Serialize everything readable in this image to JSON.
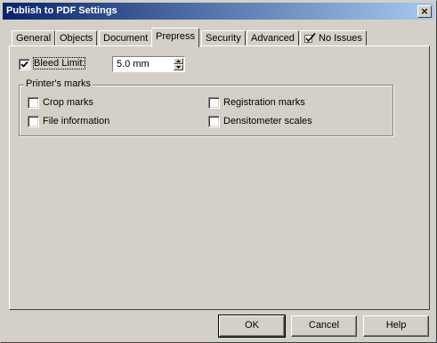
{
  "window": {
    "title": "Publish to PDF Settings",
    "close_label": "×"
  },
  "tabs": [
    {
      "label": "General",
      "active": false
    },
    {
      "label": "Objects",
      "active": false
    },
    {
      "label": "Document",
      "active": false
    },
    {
      "label": "Prepress",
      "active": true
    },
    {
      "label": "Security",
      "active": false
    },
    {
      "label": "Advanced",
      "active": false
    },
    {
      "label": "No Issues",
      "active": false,
      "icon": "check-issues-icon"
    }
  ],
  "prepress": {
    "bleed_limit": {
      "label": "Bleed Limit:",
      "checked": true,
      "value": "5.0 mm"
    },
    "printers_marks": {
      "title": "Printer's marks",
      "items": [
        {
          "label": "Crop marks",
          "checked": false
        },
        {
          "label": "Registration marks",
          "checked": false
        },
        {
          "label": "File information",
          "checked": false
        },
        {
          "label": "Densitometer scales",
          "checked": false
        }
      ]
    }
  },
  "buttons": {
    "ok": "OK",
    "cancel": "Cancel",
    "help": "Help"
  }
}
